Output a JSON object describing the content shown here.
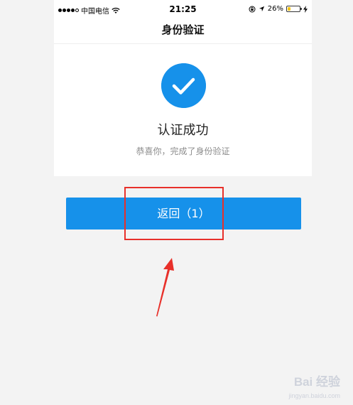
{
  "status_bar": {
    "carrier": "中国电信",
    "time": "21:25",
    "battery": "26%",
    "battery_level": 0.26
  },
  "nav": {
    "title": "身份验证"
  },
  "result": {
    "title": "认证成功",
    "subtitle": "恭喜你，完成了身份验证"
  },
  "actions": {
    "return_label": "返回（1）"
  },
  "watermark": {
    "text": "Bai 经验",
    "url": "jingyan.baidu.com"
  },
  "colors": {
    "accent": "#1691ea",
    "highlight": "#e8302a",
    "background": "#f3f3f3"
  },
  "icons": {
    "success": "checkmark-circle-icon",
    "wifi": "wifi-icon",
    "location": "location-arrow-icon",
    "lock": "orientation-lock-icon",
    "battery": "battery-icon",
    "charging": "charging-bolt-icon"
  }
}
